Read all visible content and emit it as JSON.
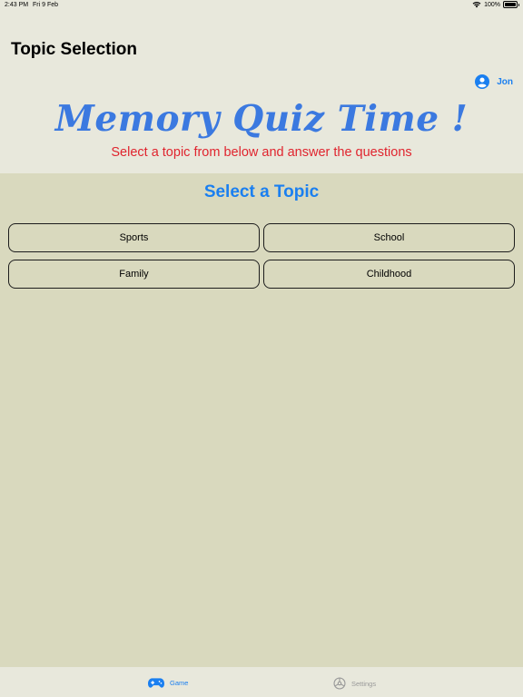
{
  "status_bar": {
    "time": "2:43 PM",
    "date": "Fri 9 Feb",
    "battery": "100%"
  },
  "header": {
    "nav_title": "Topic Selection",
    "user_name": "Jon",
    "app_title": "Memory Quiz Time !",
    "subtitle": "Select a topic from below and answer the questions"
  },
  "main": {
    "section_title": "Select a Topic",
    "topics": [
      "Sports",
      "School",
      "Family",
      "Childhood"
    ]
  },
  "tab_bar": {
    "tabs": [
      {
        "label": "Game",
        "icon": "gamepad-icon",
        "active": true
      },
      {
        "label": "Settings",
        "icon": "settings-icon",
        "active": false
      }
    ]
  },
  "colors": {
    "accent": "#1a7ff0",
    "title": "#3b79e0",
    "subtitle": "#e0242e",
    "main_bg": "#d9d9be",
    "header_bg": "#e8e8dc"
  }
}
